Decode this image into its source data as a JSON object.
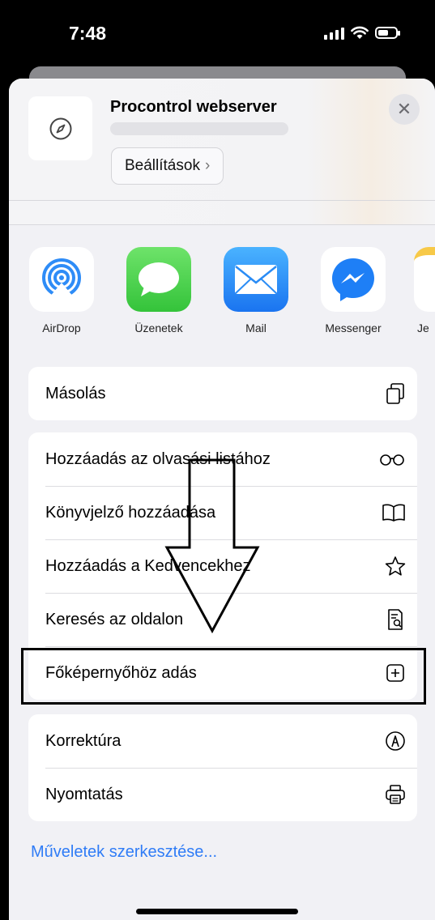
{
  "status": {
    "time": "7:48"
  },
  "header": {
    "title": "Procontrol webserver",
    "options_label": "Beállítások",
    "options_chevron": "›",
    "close_glyph": "✕"
  },
  "apps": [
    {
      "label": "AirDrop",
      "icon": "airdrop-icon"
    },
    {
      "label": "Üzenetek",
      "icon": "messages-icon"
    },
    {
      "label": "Mail",
      "icon": "mail-icon"
    },
    {
      "label": "Messenger",
      "icon": "messenger-icon"
    },
    {
      "label": "Je",
      "icon": "notes-icon"
    }
  ],
  "actions": {
    "copy": "Másolás",
    "reading_list": "Hozzáadás az olvasási listához",
    "bookmark": "Könyvjelző hozzáadása",
    "favorites": "Hozzáadás a Kedvencekhez",
    "find": "Keresés az oldalon",
    "home_screen": "Főképernyőhöz adás",
    "markup": "Korrektúra",
    "print": "Nyomtatás"
  },
  "edit_actions": "Műveletek szerkesztése...",
  "colors": {
    "link": "#2f7cf6",
    "messages": "#5bd35b",
    "mail": "#2a8cf5",
    "airdrop": "#2e8cf7"
  }
}
